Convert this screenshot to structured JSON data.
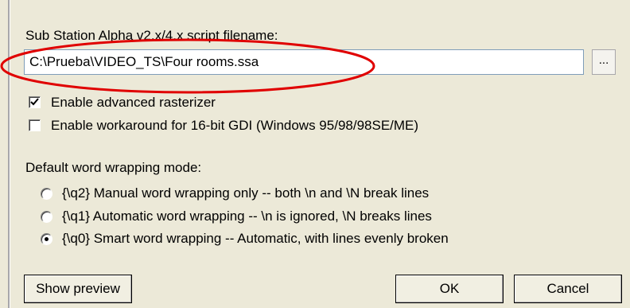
{
  "filename": {
    "label": "Sub Station Alpha v2.x/4.x script filename:",
    "value": "C:\\Prueba\\VIDEO_TS\\Four rooms.ssa",
    "browse_label": "..."
  },
  "options": {
    "advanced_rasterizer": {
      "label": "Enable advanced rasterizer",
      "checked": true
    },
    "gdi_workaround": {
      "label": "Enable workaround for 16-bit GDI (Windows 95/98/98SE/ME)",
      "checked": false
    }
  },
  "wrapping": {
    "label": "Default word wrapping mode:",
    "modes": [
      {
        "label": "{\\q2} Manual word wrapping only -- both \\n and \\N break lines",
        "selected": false
      },
      {
        "label": "{\\q1} Automatic word wrapping -- \\n is ignored, \\N breaks lines",
        "selected": false
      },
      {
        "label": "{\\q0} Smart word wrapping -- Automatic, with lines evenly broken",
        "selected": true
      }
    ]
  },
  "buttons": {
    "preview": "Show preview",
    "ok": "OK",
    "cancel": "Cancel"
  },
  "colors": {
    "dialog_bg": "#ece9d8",
    "highlight": "#e00000",
    "input_border": "#7f9db9"
  }
}
